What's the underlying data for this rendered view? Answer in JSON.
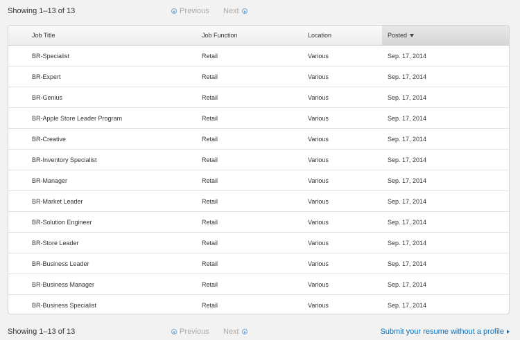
{
  "pager_top": {
    "showing": "Showing 1–13 of 13",
    "previous": "Previous",
    "next": "Next"
  },
  "pager_bottom": {
    "showing": "Showing 1–13 of 13",
    "previous": "Previous",
    "next": "Next",
    "submit_link": "Submit your resume without a profile"
  },
  "table": {
    "headers": {
      "job_title": "Job Title",
      "job_function": "Job Function",
      "location": "Location",
      "posted": "Posted"
    },
    "sorted_column": "posted",
    "sort_direction": "desc",
    "rows": [
      {
        "title": "BR-Specialist",
        "function": "Retail",
        "location": "Various",
        "posted": "Sep. 17, 2014"
      },
      {
        "title": "BR-Expert",
        "function": "Retail",
        "location": "Various",
        "posted": "Sep. 17, 2014"
      },
      {
        "title": "BR-Genius",
        "function": "Retail",
        "location": "Various",
        "posted": "Sep. 17, 2014"
      },
      {
        "title": "BR-Apple Store Leader Program",
        "function": "Retail",
        "location": "Various",
        "posted": "Sep. 17, 2014"
      },
      {
        "title": "BR-Creative",
        "function": "Retail",
        "location": "Various",
        "posted": "Sep. 17, 2014"
      },
      {
        "title": "BR-Inventory Specialist",
        "function": "Retail",
        "location": "Various",
        "posted": "Sep. 17, 2014"
      },
      {
        "title": "BR-Manager",
        "function": "Retail",
        "location": "Various",
        "posted": "Sep. 17, 2014"
      },
      {
        "title": "BR-Market Leader",
        "function": "Retail",
        "location": "Various",
        "posted": "Sep. 17, 2014"
      },
      {
        "title": "BR-Solution Engineer",
        "function": "Retail",
        "location": "Various",
        "posted": "Sep. 17, 2014"
      },
      {
        "title": "BR-Store Leader",
        "function": "Retail",
        "location": "Various",
        "posted": "Sep. 17, 2014"
      },
      {
        "title": "BR-Business Leader",
        "function": "Retail",
        "location": "Various",
        "posted": "Sep. 17, 2014"
      },
      {
        "title": "BR-Business Manager",
        "function": "Retail",
        "location": "Various",
        "posted": "Sep. 17, 2014"
      },
      {
        "title": "BR-Business Specialist",
        "function": "Retail",
        "location": "Various",
        "posted": "Sep. 17, 2014"
      }
    ]
  },
  "colors": {
    "link": "#0f6fb4",
    "disabled_nav": "#aaaaaa",
    "nav_icon": "#6fa8d8"
  }
}
